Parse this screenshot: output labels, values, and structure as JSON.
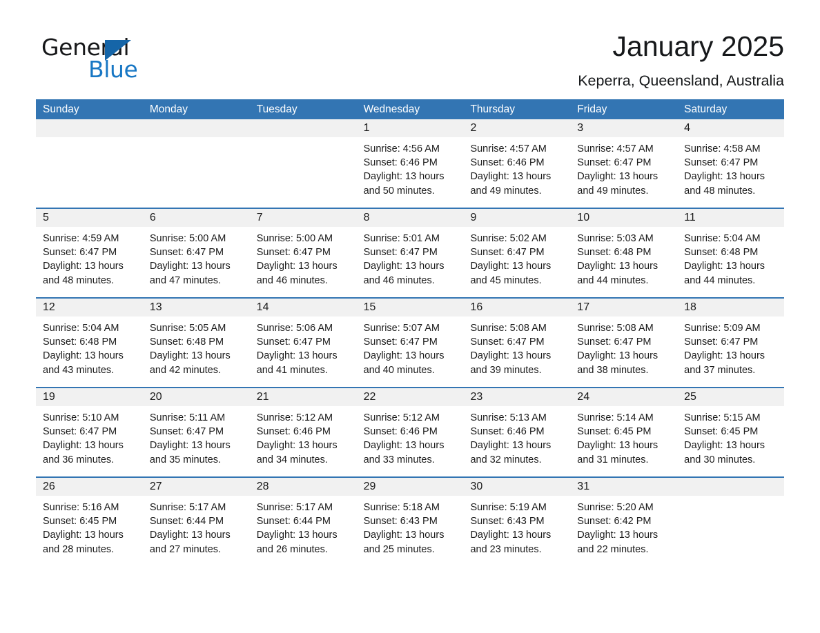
{
  "brand": {
    "name_part1": "General",
    "name_part2": "Blue",
    "triangle_color": "#1565a8",
    "blue_color": "#1877c4"
  },
  "header": {
    "month_title": "January 2025",
    "location": "Keperra, Queensland, Australia"
  },
  "theme": {
    "header_blue": "#3375b3",
    "day_band_gray": "#f1f1f1",
    "text_black": "#1a1a1a"
  },
  "calendar": {
    "weekdays": [
      "Sunday",
      "Monday",
      "Tuesday",
      "Wednesday",
      "Thursday",
      "Friday",
      "Saturday"
    ],
    "weeks": [
      [
        {
          "day": "",
          "sunrise": "",
          "sunset": "",
          "daylight_line1": "",
          "daylight_line2": ""
        },
        {
          "day": "",
          "sunrise": "",
          "sunset": "",
          "daylight_line1": "",
          "daylight_line2": ""
        },
        {
          "day": "",
          "sunrise": "",
          "sunset": "",
          "daylight_line1": "",
          "daylight_line2": ""
        },
        {
          "day": "1",
          "sunrise": "Sunrise: 4:56 AM",
          "sunset": "Sunset: 6:46 PM",
          "daylight_line1": "Daylight: 13 hours",
          "daylight_line2": "and 50 minutes."
        },
        {
          "day": "2",
          "sunrise": "Sunrise: 4:57 AM",
          "sunset": "Sunset: 6:46 PM",
          "daylight_line1": "Daylight: 13 hours",
          "daylight_line2": "and 49 minutes."
        },
        {
          "day": "3",
          "sunrise": "Sunrise: 4:57 AM",
          "sunset": "Sunset: 6:47 PM",
          "daylight_line1": "Daylight: 13 hours",
          "daylight_line2": "and 49 minutes."
        },
        {
          "day": "4",
          "sunrise": "Sunrise: 4:58 AM",
          "sunset": "Sunset: 6:47 PM",
          "daylight_line1": "Daylight: 13 hours",
          "daylight_line2": "and 48 minutes."
        }
      ],
      [
        {
          "day": "5",
          "sunrise": "Sunrise: 4:59 AM",
          "sunset": "Sunset: 6:47 PM",
          "daylight_line1": "Daylight: 13 hours",
          "daylight_line2": "and 48 minutes."
        },
        {
          "day": "6",
          "sunrise": "Sunrise: 5:00 AM",
          "sunset": "Sunset: 6:47 PM",
          "daylight_line1": "Daylight: 13 hours",
          "daylight_line2": "and 47 minutes."
        },
        {
          "day": "7",
          "sunrise": "Sunrise: 5:00 AM",
          "sunset": "Sunset: 6:47 PM",
          "daylight_line1": "Daylight: 13 hours",
          "daylight_line2": "and 46 minutes."
        },
        {
          "day": "8",
          "sunrise": "Sunrise: 5:01 AM",
          "sunset": "Sunset: 6:47 PM",
          "daylight_line1": "Daylight: 13 hours",
          "daylight_line2": "and 46 minutes."
        },
        {
          "day": "9",
          "sunrise": "Sunrise: 5:02 AM",
          "sunset": "Sunset: 6:47 PM",
          "daylight_line1": "Daylight: 13 hours",
          "daylight_line2": "and 45 minutes."
        },
        {
          "day": "10",
          "sunrise": "Sunrise: 5:03 AM",
          "sunset": "Sunset: 6:48 PM",
          "daylight_line1": "Daylight: 13 hours",
          "daylight_line2": "and 44 minutes."
        },
        {
          "day": "11",
          "sunrise": "Sunrise: 5:04 AM",
          "sunset": "Sunset: 6:48 PM",
          "daylight_line1": "Daylight: 13 hours",
          "daylight_line2": "and 44 minutes."
        }
      ],
      [
        {
          "day": "12",
          "sunrise": "Sunrise: 5:04 AM",
          "sunset": "Sunset: 6:48 PM",
          "daylight_line1": "Daylight: 13 hours",
          "daylight_line2": "and 43 minutes."
        },
        {
          "day": "13",
          "sunrise": "Sunrise: 5:05 AM",
          "sunset": "Sunset: 6:48 PM",
          "daylight_line1": "Daylight: 13 hours",
          "daylight_line2": "and 42 minutes."
        },
        {
          "day": "14",
          "sunrise": "Sunrise: 5:06 AM",
          "sunset": "Sunset: 6:47 PM",
          "daylight_line1": "Daylight: 13 hours",
          "daylight_line2": "and 41 minutes."
        },
        {
          "day": "15",
          "sunrise": "Sunrise: 5:07 AM",
          "sunset": "Sunset: 6:47 PM",
          "daylight_line1": "Daylight: 13 hours",
          "daylight_line2": "and 40 minutes."
        },
        {
          "day": "16",
          "sunrise": "Sunrise: 5:08 AM",
          "sunset": "Sunset: 6:47 PM",
          "daylight_line1": "Daylight: 13 hours",
          "daylight_line2": "and 39 minutes."
        },
        {
          "day": "17",
          "sunrise": "Sunrise: 5:08 AM",
          "sunset": "Sunset: 6:47 PM",
          "daylight_line1": "Daylight: 13 hours",
          "daylight_line2": "and 38 minutes."
        },
        {
          "day": "18",
          "sunrise": "Sunrise: 5:09 AM",
          "sunset": "Sunset: 6:47 PM",
          "daylight_line1": "Daylight: 13 hours",
          "daylight_line2": "and 37 minutes."
        }
      ],
      [
        {
          "day": "19",
          "sunrise": "Sunrise: 5:10 AM",
          "sunset": "Sunset: 6:47 PM",
          "daylight_line1": "Daylight: 13 hours",
          "daylight_line2": "and 36 minutes."
        },
        {
          "day": "20",
          "sunrise": "Sunrise: 5:11 AM",
          "sunset": "Sunset: 6:47 PM",
          "daylight_line1": "Daylight: 13 hours",
          "daylight_line2": "and 35 minutes."
        },
        {
          "day": "21",
          "sunrise": "Sunrise: 5:12 AM",
          "sunset": "Sunset: 6:46 PM",
          "daylight_line1": "Daylight: 13 hours",
          "daylight_line2": "and 34 minutes."
        },
        {
          "day": "22",
          "sunrise": "Sunrise: 5:12 AM",
          "sunset": "Sunset: 6:46 PM",
          "daylight_line1": "Daylight: 13 hours",
          "daylight_line2": "and 33 minutes."
        },
        {
          "day": "23",
          "sunrise": "Sunrise: 5:13 AM",
          "sunset": "Sunset: 6:46 PM",
          "daylight_line1": "Daylight: 13 hours",
          "daylight_line2": "and 32 minutes."
        },
        {
          "day": "24",
          "sunrise": "Sunrise: 5:14 AM",
          "sunset": "Sunset: 6:45 PM",
          "daylight_line1": "Daylight: 13 hours",
          "daylight_line2": "and 31 minutes."
        },
        {
          "day": "25",
          "sunrise": "Sunrise: 5:15 AM",
          "sunset": "Sunset: 6:45 PM",
          "daylight_line1": "Daylight: 13 hours",
          "daylight_line2": "and 30 minutes."
        }
      ],
      [
        {
          "day": "26",
          "sunrise": "Sunrise: 5:16 AM",
          "sunset": "Sunset: 6:45 PM",
          "daylight_line1": "Daylight: 13 hours",
          "daylight_line2": "and 28 minutes."
        },
        {
          "day": "27",
          "sunrise": "Sunrise: 5:17 AM",
          "sunset": "Sunset: 6:44 PM",
          "daylight_line1": "Daylight: 13 hours",
          "daylight_line2": "and 27 minutes."
        },
        {
          "day": "28",
          "sunrise": "Sunrise: 5:17 AM",
          "sunset": "Sunset: 6:44 PM",
          "daylight_line1": "Daylight: 13 hours",
          "daylight_line2": "and 26 minutes."
        },
        {
          "day": "29",
          "sunrise": "Sunrise: 5:18 AM",
          "sunset": "Sunset: 6:43 PM",
          "daylight_line1": "Daylight: 13 hours",
          "daylight_line2": "and 25 minutes."
        },
        {
          "day": "30",
          "sunrise": "Sunrise: 5:19 AM",
          "sunset": "Sunset: 6:43 PM",
          "daylight_line1": "Daylight: 13 hours",
          "daylight_line2": "and 23 minutes."
        },
        {
          "day": "31",
          "sunrise": "Sunrise: 5:20 AM",
          "sunset": "Sunset: 6:42 PM",
          "daylight_line1": "Daylight: 13 hours",
          "daylight_line2": "and 22 minutes."
        },
        {
          "day": "",
          "sunrise": "",
          "sunset": "",
          "daylight_line1": "",
          "daylight_line2": ""
        }
      ]
    ]
  }
}
